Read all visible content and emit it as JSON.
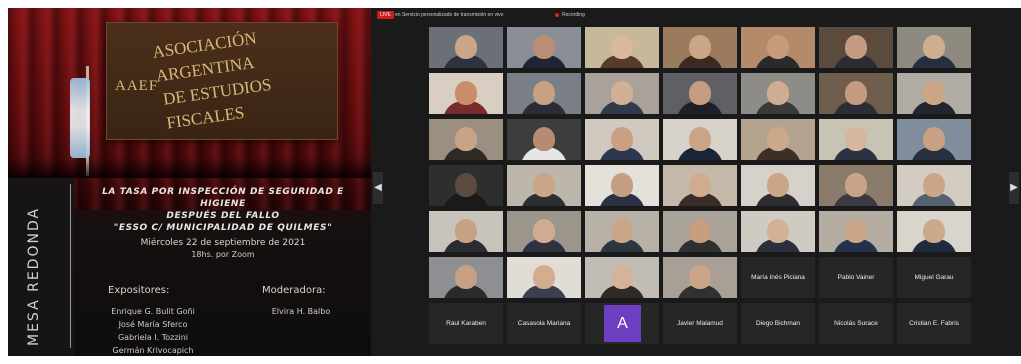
{
  "poster": {
    "sign_line1": "ASOCIACIÓN ARGENTINA",
    "sign_line2": "DE ESTUDIOS FISCALES",
    "logo_text": "AAEF",
    "vertical_title": "MESA REDONDA",
    "topic_lines": [
      "LA TASA POR INSPECCIÓN DE SEGURIDAD E HIGIENE",
      "DESPUÉS DEL FALLO",
      "\"ESSO C/ MUNICIPALIDAD DE QUILMES\""
    ],
    "date": "Miércoles 22 de septiembre de 2021",
    "time": "18hs. por Zoom",
    "expositores_header": "Expositores:",
    "moderadora_header": "Moderadora:",
    "expositores": [
      "Enrique G. Bulit Goñi",
      "José María Sferco",
      "Gabriela I. Tozzini",
      "Germán Krivocapich"
    ],
    "moderadora": "Elvira H. Balbo"
  },
  "zoom": {
    "live_badge": "LIVE",
    "live_text": "en Servicio personalizado de transmisión en vivo",
    "recording_label": "Recording",
    "nav_left": "◀",
    "nav_right": "▶",
    "video_tiles": [
      {
        "bg": "#6b6f78",
        "skin": "#caa587",
        "shirt": "#2d3240"
      },
      {
        "bg": "#8a8e96",
        "skin": "#b98e72",
        "shirt": "#1e2433"
      },
      {
        "bg": "#c7b79b",
        "skin": "#d9b89b",
        "shirt": "#5a3a2a"
      },
      {
        "bg": "#9b7b5d",
        "skin": "#caa587",
        "shirt": "#3b2a22"
      },
      {
        "bg": "#b58a6a",
        "skin": "#c79a7a",
        "shirt": "#2a2a2a"
      },
      {
        "bg": "#5c4a3c",
        "skin": "#c49a80",
        "shirt": "#2b2b33"
      },
      {
        "bg": "#8f8a7f",
        "skin": "#cfad91",
        "shirt": "#24303f"
      },
      {
        "bg": "#d8cfc2",
        "skin": "#c98d6a",
        "shirt": "#7a2b2b"
      },
      {
        "bg": "#7a7f85",
        "skin": "#c8a184",
        "shirt": "#2c2c34"
      },
      {
        "bg": "#a8a29a",
        "skin": "#d2b095",
        "shirt": "#303a4a"
      },
      {
        "bg": "#5e6066",
        "skin": "#c59d80",
        "shirt": "#1f1f26"
      },
      {
        "bg": "#8d8c87",
        "skin": "#d0ad90",
        "shirt": "#3a3a3a"
      },
      {
        "bg": "#6f5d4d",
        "skin": "#c39c80",
        "shirt": "#2d2d38"
      },
      {
        "bg": "#b0aca4",
        "skin": "#cba687",
        "shirt": "#23262e"
      },
      {
        "bg": "#9a8f80",
        "skin": "#c9a386",
        "shirt": "#2e2a26"
      },
      {
        "bg": "#3d3d3d",
        "skin": "#b48c70",
        "shirt": "#e6e6e6"
      },
      {
        "bg": "#cfc9bf",
        "skin": "#c9a083",
        "shirt": "#2c3850"
      },
      {
        "bg": "#d7d2c9",
        "skin": "#caa587",
        "shirt": "#1c2538"
      },
      {
        "bg": "#b4a38f",
        "skin": "#cda98c",
        "shirt": "#3a3026"
      },
      {
        "bg": "#c9c3b6",
        "skin": "#d6b69c",
        "shirt": "#2b3240"
      },
      {
        "bg": "#7f8d9c",
        "skin": "#c8a083",
        "shirt": "#27303d"
      },
      {
        "bg": "#2e2e2e",
        "skin": "#5a4a40",
        "shirt": "#1a1a1a"
      },
      {
        "bg": "#bcb6ab",
        "skin": "#caa689",
        "shirt": "#2e2e2e"
      },
      {
        "bg": "#e4e0da",
        "skin": "#c69e82",
        "shirt": "#2a3142"
      },
      {
        "bg": "#c5b9a9",
        "skin": "#d0ab8e",
        "shirt": "#3a2d28"
      },
      {
        "bg": "#d6d1ca",
        "skin": "#caa587",
        "shirt": "#2b2b30"
      },
      {
        "bg": "#8a7b6b",
        "skin": "#c9a387",
        "shirt": "#3a3a40"
      },
      {
        "bg": "#d2ccc3",
        "skin": "#cba686",
        "shirt": "#556070"
      },
      {
        "bg": "#c8c3bb",
        "skin": "#c8a083",
        "shirt": "#2b2b33"
      },
      {
        "bg": "#9c958b",
        "skin": "#cfac90",
        "shirt": "#2c3240"
      },
      {
        "bg": "#b7b1a8",
        "skin": "#caa587",
        "shirt": "#2d3541"
      },
      {
        "bg": "#a9a39a",
        "skin": "#c79e80",
        "shirt": "#303030"
      },
      {
        "bg": "#cfcac2",
        "skin": "#d3b195",
        "shirt": "#2b2f3a"
      },
      {
        "bg": "#b5ada1",
        "skin": "#caa587",
        "shirt": "#27304a"
      },
      {
        "bg": "#d9d4cc",
        "skin": "#cda98c",
        "shirt": "#1f2a3a"
      },
      {
        "bg": "#8d8f93",
        "skin": "#c7a083",
        "shirt": "#2a2a2a"
      },
      {
        "bg": "#e1ddd6",
        "skin": "#d1ae92",
        "shirt": "#3a4050"
      },
      {
        "bg": "#c2bdb4",
        "skin": "#d5b398",
        "shirt": "#2e2a28"
      },
      {
        "bg": "#a8a096",
        "skin": "#cba587",
        "shirt": "#30302e"
      },
      {
        "bg": "#bcb5aa",
        "skin": "#caa587",
        "shirt": "#7a1d1d"
      }
    ],
    "row6_names": [
      "María Inés Piciana",
      "Pablo Vainer",
      "Miguel Garau"
    ],
    "row7_names_left": [
      "Raul Karaben",
      "Casasola Mariana"
    ],
    "avatar_letter": "A",
    "row7_names_right": [
      "Javier Malamud",
      "Diego Bichman",
      "Nicolás Surace",
      "Cristian E. Fabris"
    ],
    "avatar_color": "#6c3fc0"
  }
}
